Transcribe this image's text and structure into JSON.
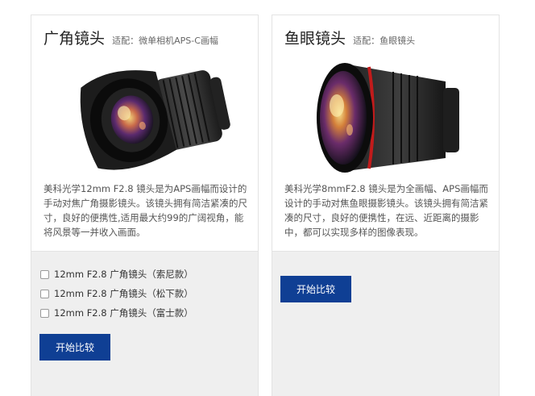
{
  "cards": [
    {
      "title": "广角镜头",
      "fit_text": "适配：微单相机APS-C画幅",
      "description": "美科光学12mm F2.8 镜头是为APS画幅而设计的手动对焦广角摄影镜头。该镜头拥有简洁紧凑的尺寸，良好的便携性,适用最大约99的广阔视角，能将风景等一并收入画面。",
      "options": [
        "12mm F2.8 广角镜头（索尼款）",
        "12mm F2.8 广角镜头（松下款）",
        "12mm F2.8 广角镜头（富士款）"
      ],
      "button_label": "开始比较"
    },
    {
      "title": "鱼眼镜头",
      "fit_text": "适配：鱼眼镜头",
      "description": "美科光学8mmF2.8 镜头是为全画幅、APS画幅而设计的手动对焦鱼眼摄影镜头。该镜头拥有简洁紧凑的尺寸，良好的便携性，在远、近距离的摄影中，都可以实现多样的图像表现。",
      "options": [],
      "button_label": "开始比较"
    }
  ],
  "colors": {
    "button_bg": "#0f3f94",
    "footer_bg": "#efefef",
    "card_border": "#e3e3e3"
  }
}
